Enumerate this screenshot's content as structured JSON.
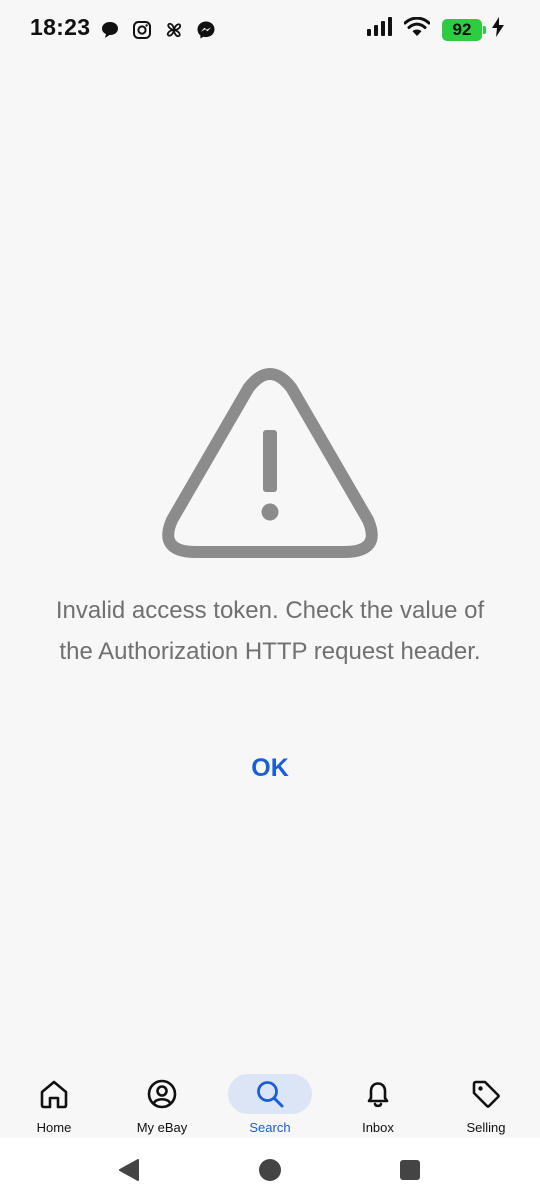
{
  "status_bar": {
    "time": "18:23",
    "battery_level": "92",
    "notification_icons": [
      "chat-bubble-icon",
      "instagram-icon",
      "pinwheel-icon",
      "messenger-icon"
    ],
    "system_icons": [
      "signal-icon",
      "wifi-icon",
      "battery-icon",
      "charging-bolt-icon"
    ]
  },
  "error": {
    "icon": "warning-triangle-icon",
    "message": "Invalid access token. Check the value of the Authorization HTTP request header.",
    "ok_label": "OK"
  },
  "bottom_nav": {
    "items": [
      {
        "label": "Home",
        "icon": "home-icon"
      },
      {
        "label": "My eBay",
        "icon": "account-icon"
      },
      {
        "label": "Search",
        "icon": "search-icon"
      },
      {
        "label": "Inbox",
        "icon": "bell-icon"
      },
      {
        "label": "Selling",
        "icon": "tag-icon"
      }
    ],
    "active_index": 2
  },
  "system_nav": {
    "buttons": [
      "back-icon",
      "home-circle-icon",
      "recents-icon"
    ]
  },
  "colors": {
    "background": "#f7f7f7",
    "accent_blue": "#1a5fd6",
    "active_pill": "#dbe5f5",
    "warning_gray": "#8c8c8c",
    "message_gray": "#707070",
    "battery_green": "#2ecc40"
  }
}
